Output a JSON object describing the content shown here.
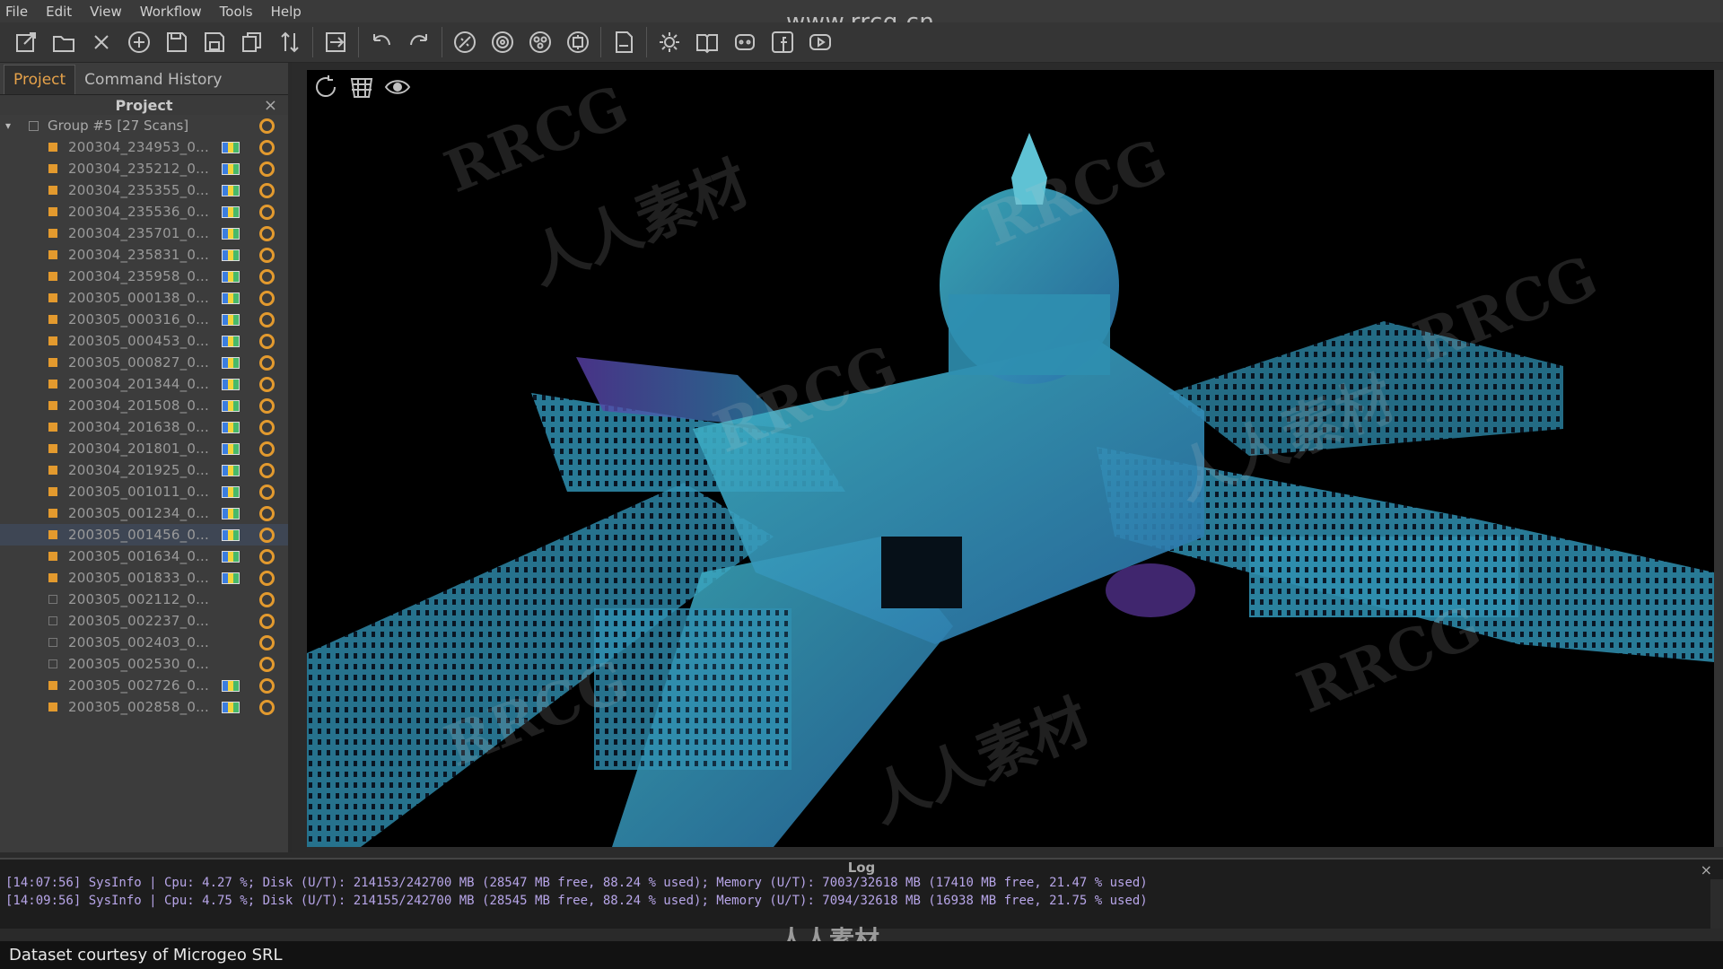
{
  "menu": [
    "File",
    "Edit",
    "View",
    "Workflow",
    "Tools",
    "Help"
  ],
  "watermark_url": "www.rrcg.cn",
  "toolbar_icons": [
    "new-project-icon",
    "open-folder-icon",
    "close-icon",
    "add-icon",
    "save-icon",
    "save-as-icon",
    "copy-icon",
    "sort-icon",
    "export-icon",
    "undo-icon",
    "redo-icon",
    "register-icon",
    "target-icon",
    "cluster-icon",
    "align-icon",
    "pdf-icon",
    "settings-icon",
    "manual-icon",
    "discord-icon",
    "facebook-icon",
    "youtube-icon"
  ],
  "left_panel": {
    "tabs": [
      "Project",
      "Command History"
    ],
    "active_tab": "Project",
    "header": "Project",
    "close": "×",
    "group_label": "Group #5 [27 Scans]",
    "scans": [
      {
        "name": "200304_234953_0...",
        "checked": true,
        "has_image": true
      },
      {
        "name": "200304_235212_0...",
        "checked": true,
        "has_image": true
      },
      {
        "name": "200304_235355_0...",
        "checked": true,
        "has_image": true
      },
      {
        "name": "200304_235536_0...",
        "checked": true,
        "has_image": true
      },
      {
        "name": "200304_235701_0...",
        "checked": true,
        "has_image": true
      },
      {
        "name": "200304_235831_0...",
        "checked": true,
        "has_image": true
      },
      {
        "name": "200304_235958_0...",
        "checked": true,
        "has_image": true
      },
      {
        "name": "200305_000138_0...",
        "checked": true,
        "has_image": true
      },
      {
        "name": "200305_000316_0...",
        "checked": true,
        "has_image": true
      },
      {
        "name": "200305_000453_0...",
        "checked": true,
        "has_image": true
      },
      {
        "name": "200305_000827_0...",
        "checked": true,
        "has_image": true
      },
      {
        "name": "200304_201344_0...",
        "checked": true,
        "has_image": true
      },
      {
        "name": "200304_201508_0...",
        "checked": true,
        "has_image": true
      },
      {
        "name": "200304_201638_0...",
        "checked": true,
        "has_image": true
      },
      {
        "name": "200304_201801_0...",
        "checked": true,
        "has_image": true
      },
      {
        "name": "200304_201925_0...",
        "checked": true,
        "has_image": true
      },
      {
        "name": "200305_001011_0...",
        "checked": true,
        "has_image": true
      },
      {
        "name": "200305_001234_0...",
        "checked": true,
        "has_image": true
      },
      {
        "name": "200305_001456_0...",
        "checked": true,
        "has_image": true,
        "selected": true
      },
      {
        "name": "200305_001634_0...",
        "checked": true,
        "has_image": true
      },
      {
        "name": "200305_001833_0...",
        "checked": true,
        "has_image": true
      },
      {
        "name": "200305_002112_0...",
        "checked": false,
        "has_image": false
      },
      {
        "name": "200305_002237_0...",
        "checked": false,
        "has_image": false
      },
      {
        "name": "200305_002403_0...",
        "checked": false,
        "has_image": false
      },
      {
        "name": "200305_002530_0...",
        "checked": false,
        "has_image": false
      },
      {
        "name": "200305_002726_0...",
        "checked": true,
        "has_image": true
      },
      {
        "name": "200305_002858_0...",
        "checked": true,
        "has_image": true
      }
    ]
  },
  "viewport": {
    "tools": [
      "rotate-icon",
      "clip-box-icon",
      "visibility-icon"
    ]
  },
  "log": {
    "title": "Log",
    "close": "×",
    "lines": [
      "[14:07:56] SysInfo | Cpu: 4.27 %; Disk (U/T): 214153/242700 MB (28547 MB free, 88.24 % used); Memory (U/T): 7003/32618 MB (17410 MB free, 21.47 % used)",
      "[14:09:56] SysInfo | Cpu: 4.75 %; Disk (U/T): 214155/242700 MB (28545 MB free, 88.24 % used); Memory (U/T): 7094/32618 MB (16938 MB free, 21.75 % used)"
    ]
  },
  "status_text": "Dataset courtesy of Microgeo SRL",
  "watermark_logo": "人人素材",
  "watermark_text": "RRCG",
  "colors": {
    "accent": "#e39a2e",
    "log_text": "#b7a5e8",
    "point_cloud_primary": "#2aa0b8",
    "point_cloud_secondary": "#7a4bc4"
  }
}
